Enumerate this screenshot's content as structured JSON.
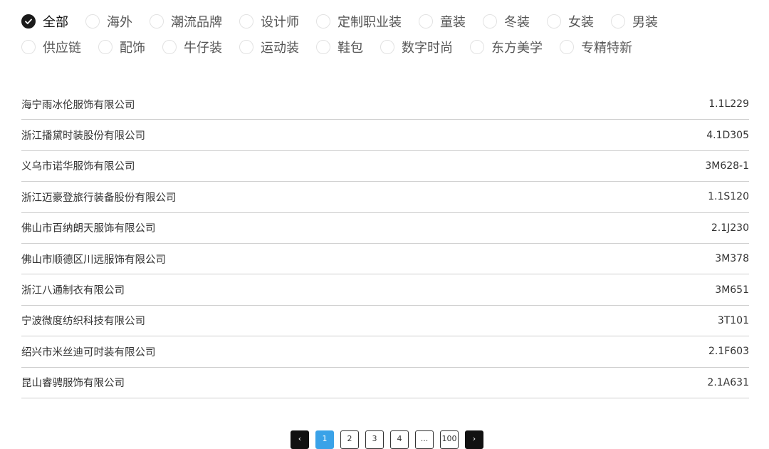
{
  "filters": {
    "row1": [
      {
        "label": "全部",
        "checked": true
      },
      {
        "label": "海外",
        "checked": false
      },
      {
        "label": "潮流品牌",
        "checked": false
      },
      {
        "label": "设计师",
        "checked": false
      },
      {
        "label": "定制职业装",
        "checked": false
      },
      {
        "label": "童装",
        "checked": false
      },
      {
        "label": "冬装",
        "checked": false
      },
      {
        "label": "女装",
        "checked": false
      },
      {
        "label": "男装",
        "checked": false
      }
    ],
    "row2": [
      {
        "label": "供应链",
        "checked": false
      },
      {
        "label": "配饰",
        "checked": false
      },
      {
        "label": "牛仔装",
        "checked": false
      },
      {
        "label": "运动装",
        "checked": false
      },
      {
        "label": "鞋包",
        "checked": false
      },
      {
        "label": "数字时尚",
        "checked": false
      },
      {
        "label": "东方美学",
        "checked": false
      },
      {
        "label": "专精特新",
        "checked": false
      }
    ]
  },
  "companies": [
    {
      "name": "海宁雨冰伦服饰有限公司",
      "booth": "1.1L229"
    },
    {
      "name": "浙江播黛时装股份有限公司",
      "booth": "4.1D305"
    },
    {
      "name": "义乌市诺华服饰有限公司",
      "booth": "3M628-1"
    },
    {
      "name": "浙江迈豪登旅行装备股份有限公司",
      "booth": "1.1S120"
    },
    {
      "name": "佛山市百纳朗天服饰有限公司",
      "booth": "2.1J230"
    },
    {
      "name": "佛山市顺德区川远服饰有限公司",
      "booth": "3M378"
    },
    {
      "name": "浙江八通制衣有限公司",
      "booth": "3M651"
    },
    {
      "name": "宁波微度纺织科技有限公司",
      "booth": "3T101"
    },
    {
      "name": "绍兴市米丝迪可时装有限公司",
      "booth": "2.1F603"
    },
    {
      "name": "昆山睿骋服饰有限公司",
      "booth": "2.1A631"
    }
  ],
  "pagination": {
    "first": "‹",
    "pages": [
      "1",
      "2",
      "3",
      "4",
      "...",
      "100"
    ],
    "current_page": "1",
    "next": "›",
    "icons": [
      "chevron-left-icon",
      "chevron-right-icon"
    ]
  },
  "colors": {
    "accent": "#3aa2e8",
    "checked": "#1a1a1a",
    "divider": "#cfcfcf"
  }
}
